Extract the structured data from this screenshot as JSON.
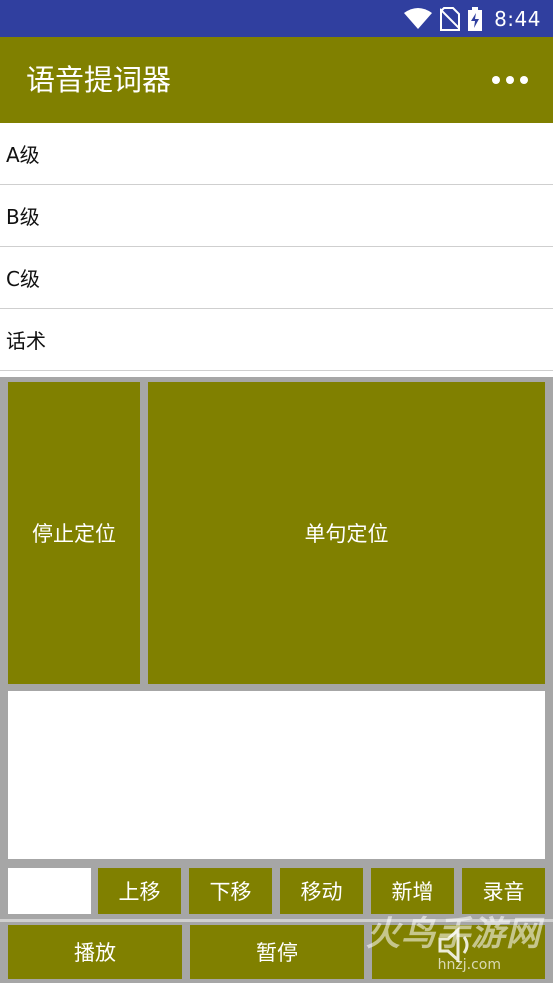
{
  "status_bar": {
    "time": "8:44",
    "icons": [
      "wifi-icon",
      "no-sim-icon",
      "battery-charging-icon"
    ]
  },
  "app_bar": {
    "title": "语音提词器",
    "menu_icon": "more-horizontal-icon"
  },
  "list": {
    "items": [
      {
        "label": "A级"
      },
      {
        "label": "B级"
      },
      {
        "label": "C级"
      },
      {
        "label": "话术"
      }
    ]
  },
  "controls": {
    "stop_locate": "停止定位",
    "single_locate": "单句定位",
    "move_up": "上移",
    "move_down": "下移",
    "move": "移动",
    "add": "新增",
    "record": "录音",
    "play": "播放",
    "pause": "暂停"
  },
  "colors": {
    "primary": "#808000",
    "status_bar": "#303F9F",
    "panel_bg": "#A6A6A6"
  },
  "watermark": {
    "logo_text": "火鸟手游网",
    "sub_text": "hnzj.com"
  }
}
